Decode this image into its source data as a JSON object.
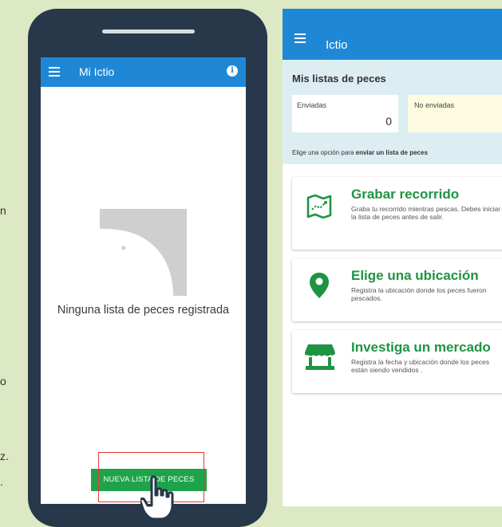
{
  "left_edge_fragments": [
    "n",
    "o",
    "z.",
    "."
  ],
  "phone1": {
    "app_title": "Mi Ictio",
    "empty_message": "Ninguna lista de peces registrada",
    "new_list_button": "NUEVA LISTA DE PECES",
    "icons": {
      "menu": "hamburger-menu-icon",
      "info": "info-icon",
      "empty": "fish-placeholder-icon",
      "pointer": "pointing-hand-icon"
    }
  },
  "phone2": {
    "app_title": "Ictio",
    "lists_heading": "Mis listas de peces",
    "sent_label": "Enviadas",
    "sent_count": "0",
    "unsent_label": "No enviadas",
    "instruction_prefix": "Elige una opción para",
    "instruction_bold": "enviar un lista de peces",
    "options": [
      {
        "title": "Grabar recorrido",
        "description": "Graba tu recorrido mientras pescas. Debes iniciar la lista de peces antes de salir.",
        "icon": "map-route-icon"
      },
      {
        "title": "Elige una ubicación",
        "description": "Registra la ubicación donde los peces fueron pescados.",
        "icon": "location-pin-icon"
      },
      {
        "title": "Investiga un mercado",
        "description": "Registra la fecha y ubicación donde los peces están siendo vendidos .",
        "icon": "market-stall-icon"
      }
    ]
  },
  "colors": {
    "appbar": "#1f88d6",
    "accent_green": "#1e9442",
    "button_green": "#1fa34a",
    "highlight_red": "#e53935",
    "background": "#dde8c4"
  }
}
